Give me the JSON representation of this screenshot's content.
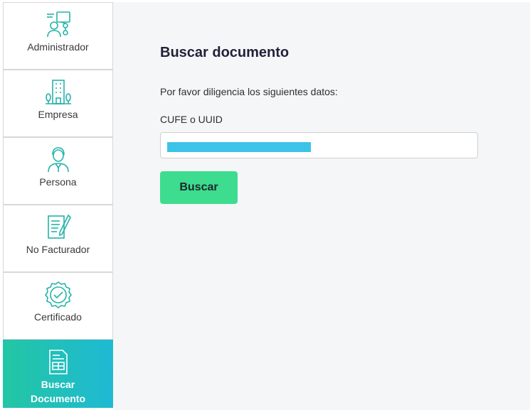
{
  "sidebar": {
    "items": [
      {
        "label": "Administrador",
        "icon": "admin-network-icon"
      },
      {
        "label": "Empresa",
        "icon": "building-icon"
      },
      {
        "label": "Persona",
        "icon": "person-icon"
      },
      {
        "label": "No Facturador",
        "icon": "document-pen-icon"
      },
      {
        "label": "Certificado",
        "icon": "certificate-badge-icon"
      },
      {
        "label_line1": "Buscar",
        "label_line2": "Documento",
        "icon": "search-document-icon",
        "active": true
      }
    ]
  },
  "main": {
    "title": "Buscar documento",
    "instructions": "Por favor diligencia los siguientes datos:",
    "field_label": "CUFE o UUID",
    "field_value": "",
    "button_label": "Buscar"
  },
  "colors": {
    "accent_teal": "#23c6a3",
    "accent_blue": "#1fb9d4",
    "button_green": "#3ddc8f",
    "icon_teal": "#26b3a8",
    "redaction": "#3ec3e8"
  }
}
